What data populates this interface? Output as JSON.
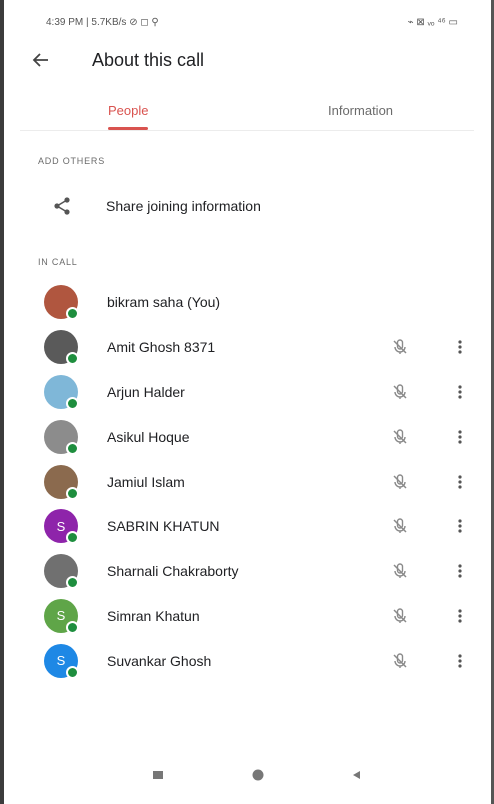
{
  "status_bar": {
    "left": "4:39 PM | 5.7KB/s ⊘ ◻ ⚲",
    "right": "⌁ ⊠ ᵥₒ ⁴⁶ ▭"
  },
  "app_bar": {
    "title": "About this call"
  },
  "tabs": [
    {
      "label": "People",
      "active": true
    },
    {
      "label": "Information",
      "active": false
    }
  ],
  "add_others": {
    "header": "ADD OTHERS",
    "share_label": "Share joining information"
  },
  "in_call": {
    "header": "IN CALL",
    "participants": [
      {
        "name": "bikram saha (You)",
        "initial": "",
        "color": "#b0563f",
        "muted": false
      },
      {
        "name": "Amit Ghosh 8371",
        "initial": "",
        "color": "#5a5a5a",
        "muted": true
      },
      {
        "name": "Arjun Halder",
        "initial": "",
        "color": "#7fb7d8",
        "muted": true
      },
      {
        "name": "Asikul Hoque",
        "initial": "",
        "color": "#8c8c8c",
        "muted": true
      },
      {
        "name": "Jamiul Islam",
        "initial": "",
        "color": "#8b6a4e",
        "muted": true
      },
      {
        "name": "SABRIN KHATUN",
        "initial": "S",
        "color": "#8e24aa",
        "muted": true
      },
      {
        "name": "Sharnali Chakraborty",
        "initial": "",
        "color": "#707070",
        "muted": true
      },
      {
        "name": "Simran Khatun",
        "initial": "S",
        "color": "#5fa548",
        "muted": true
      },
      {
        "name": "Suvankar Ghosh",
        "initial": "S",
        "color": "#1e88e5",
        "muted": true
      }
    ]
  },
  "colors": {
    "accent": "#d9534f",
    "online": "#1e8e3e"
  }
}
